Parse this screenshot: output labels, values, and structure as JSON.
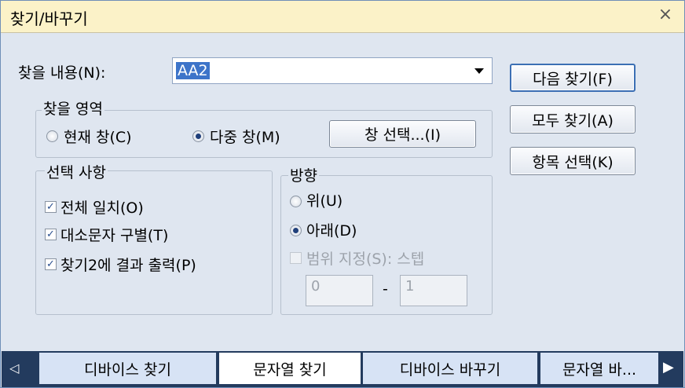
{
  "window": {
    "title": "찾기/바꾸기",
    "close_glyph": "×"
  },
  "find": {
    "label": "찾을 내용(N):",
    "value": "AA2"
  },
  "buttons": {
    "find_next": "다음 찾기(F)",
    "find_all": "모두 찾기(A)",
    "item_select": "항목 선택(K)"
  },
  "scope": {
    "legend": "찾을 영역",
    "current_window": "현재 창(C)",
    "multi_window": "다중 창(M)",
    "selected": "multi_window",
    "window_select_button": "창 선택...(I)"
  },
  "options": {
    "legend": "선택 사항",
    "items": [
      {
        "label": "전체 일치(O)",
        "checked": true
      },
      {
        "label": "대소문자 구별(T)",
        "checked": true
      },
      {
        "label": "찾기2에 결과 출력(P)",
        "checked": true
      }
    ]
  },
  "direction": {
    "legend": "방향",
    "up": "위(U)",
    "down": "아래(D)",
    "selected": "down",
    "range_label": "범위 지정(S): 스텝",
    "range_from": "0",
    "range_separator": "-",
    "range_to": "1"
  },
  "tabs": {
    "items": [
      "디바이스 찾기",
      "문자열 찾기",
      "디바이스 바꾸기",
      "문자열 바..."
    ],
    "active_index": 1,
    "left_arrow": "◁",
    "right_arrow": "▶"
  }
}
